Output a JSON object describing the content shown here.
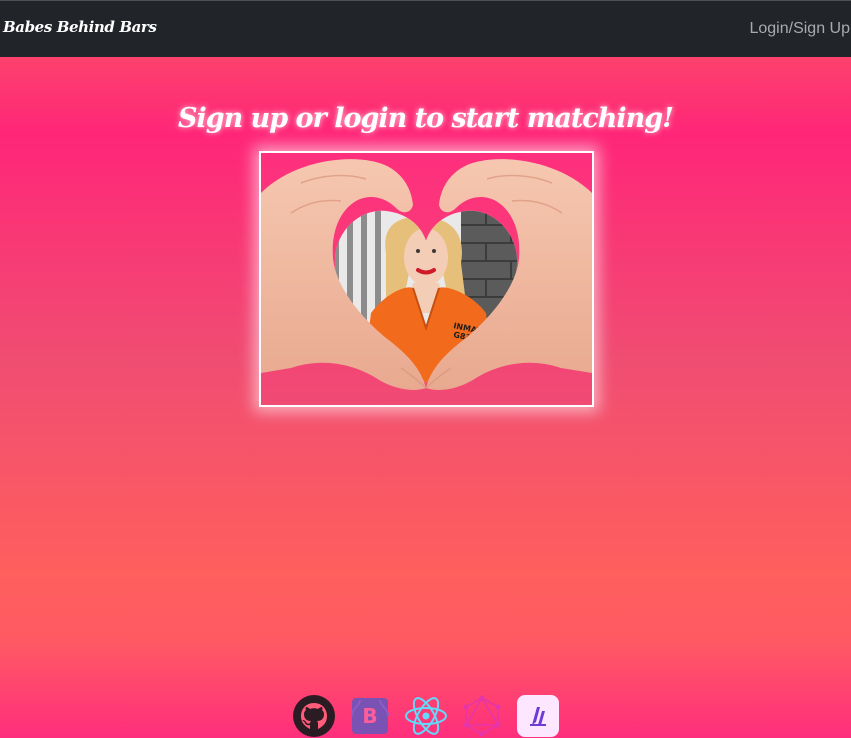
{
  "navbar": {
    "brand": "Babes Behind Bars",
    "login_link": "Login/Sign Up"
  },
  "main": {
    "headline": "Sign up or login to start matching!",
    "hero_image": {
      "alt": "heart hands framing an inmate",
      "badge_text_line1": "INMAT",
      "badge_text_line2": "G83"
    }
  },
  "footer": {
    "icons": [
      "github-icon",
      "bootstrap-icon",
      "react-icon",
      "graphql-icon",
      "apollo-icon"
    ]
  },
  "colors": {
    "navbar_bg": "#212529",
    "nav_link": "#a8aaad",
    "gradient_pink": "#ff2678",
    "gradient_coral": "#ff5f5d",
    "bootstrap_purple": "#7952b3",
    "react_blue": "#61dafb",
    "graphql_magenta": "#e535ab"
  }
}
